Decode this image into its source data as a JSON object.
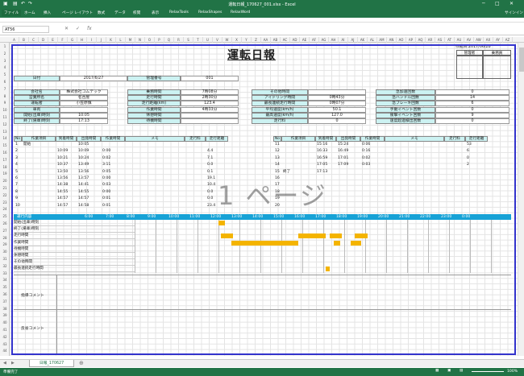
{
  "app": {
    "title": "運転日報_170627_001.xlsx - Excel",
    "signin": "サインイン"
  },
  "ribbon": {
    "tabs": [
      "ファイル",
      "ホーム",
      "挿入",
      "ページ レイアウト",
      "数式",
      "データ",
      "校閲",
      "表示",
      "RelaxTools",
      "RelaxShapes",
      "RelaxWord"
    ]
  },
  "formula": {
    "namebox": "AT56",
    "fx": "fx"
  },
  "sheet": {
    "title": "運転日報",
    "created": "作成日:2017/06/28",
    "stamps": [
      "管理者",
      "乗務員"
    ],
    "date_label": "日付",
    "date_value": "2017/6/27",
    "mgmt_label": "管理番号",
    "mgmt_value": "001",
    "info": {
      "left": [
        [
          "会社名",
          "株式会社コムテック"
        ],
        [
          "営業所名",
          "名古屋"
        ],
        [
          "運転者",
          "小笠原慎"
        ],
        [
          "車両",
          ""
        ],
        [
          "開始(出庫)時刻",
          "10:05"
        ],
        [
          "終了(帰庫)時刻",
          "17:13"
        ]
      ],
      "mid": [
        [
          "乗務時間",
          "7時08分"
        ],
        [
          "走行時間",
          "2時30分"
        ],
        [
          "走行距離(km)",
          "123.4"
        ],
        [
          "作業時間",
          "4時33分"
        ],
        [
          "休憩時間",
          ""
        ],
        [
          "待機時間",
          ""
        ]
      ],
      "mid2": [
        [
          "その他時間",
          ""
        ],
        [
          "アイドリング時間",
          "0時43分"
        ],
        [
          "最長連続走行時間",
          "0時07分"
        ],
        [
          "平均速度(km/h)",
          "50.1"
        ],
        [
          "最高速度(km/h)",
          "127.0"
        ],
        [
          "走行料",
          "0"
        ]
      ],
      "right": [
        [
          "急加速回数",
          "0"
        ],
        [
          "急ハンドル回数",
          "14"
        ],
        [
          "急ブレーキ回数",
          "6"
        ],
        [
          "手動イベント回数",
          "0"
        ],
        [
          "衝撃イベント回数",
          "9"
        ],
        [
          "速度超過検出回数",
          "0"
        ]
      ]
    },
    "log_headers": [
      "No",
      "作業項目",
      "到着時間",
      "出発時間",
      "作業時間",
      "メモ",
      "走行料",
      "走行距離"
    ],
    "log_left": [
      [
        "1",
        "開始",
        "",
        "10:05",
        "",
        "",
        "",
        ""
      ],
      [
        "2",
        "",
        "10:09",
        "10:09",
        "0:00",
        "",
        "",
        "4.4"
      ],
      [
        "3",
        "",
        "10:21",
        "10:24",
        "0:02",
        "",
        "",
        "7.1"
      ],
      [
        "4",
        "",
        "10:37",
        "13:49",
        "3:11",
        "",
        "",
        "0.0"
      ],
      [
        "5",
        "",
        "13:50",
        "13:56",
        "0:05",
        "",
        "",
        "0.1"
      ],
      [
        "6",
        "",
        "13:56",
        "13:57",
        "0:00",
        "",
        "",
        "19.1"
      ],
      [
        "7",
        "",
        "14:38",
        "14:41",
        "0:03",
        "",
        "",
        "10.4"
      ],
      [
        "8",
        "",
        "14:55",
        "14:55",
        "0:00",
        "",
        "",
        "0.0"
      ],
      [
        "9",
        "",
        "14:57",
        "14:57",
        "0:01",
        "",
        "",
        "0.0"
      ],
      [
        "10",
        "",
        "14:57",
        "14:58",
        "0:01",
        "",
        "",
        "23.4"
      ]
    ],
    "log_right": [
      [
        "11",
        "",
        "15:16",
        "15:24",
        "0:06",
        "",
        "",
        "53"
      ],
      [
        "12",
        "",
        "16:33",
        "16:49",
        "0:16",
        "",
        "",
        "6"
      ],
      [
        "13",
        "",
        "16:59",
        "17:01",
        "0:02",
        "",
        "",
        "0"
      ],
      [
        "14",
        "",
        "17:05",
        "17:09",
        "0:03",
        "",
        "",
        "2"
      ],
      [
        "15",
        "終了",
        "17:13",
        "",
        "",
        "",
        "",
        ""
      ],
      [
        "16",
        "",
        "",
        "",
        "",
        "",
        "",
        ""
      ],
      [
        "17",
        "",
        "",
        "",
        "",
        "",
        "",
        ""
      ],
      [
        "18",
        "",
        "",
        "",
        "",
        "",
        "",
        ""
      ],
      [
        "19",
        "",
        "",
        "",
        "",
        "",
        "",
        ""
      ],
      [
        "20",
        "",
        "",
        "",
        "",
        "",
        "",
        ""
      ]
    ],
    "watermark": "1 ページ",
    "timeline_label": "運行内容",
    "timeline_hours": [
      "6:00",
      "7:00",
      "8:00",
      "9:00",
      "10:00",
      "11:00",
      "12:00",
      "13:00",
      "14:00",
      "15:00",
      "16:00",
      "17:00",
      "18:00",
      "19:00",
      "20:00",
      "21:00",
      "22:00",
      "23:00",
      "0:00"
    ],
    "timeline_rows": [
      "開始(出庫)時刻",
      "終了(帰庫)時刻",
      "走行時間",
      "作業時間",
      "待機時間",
      "休憩時間",
      "その他時間",
      "最長連続走行時間"
    ],
    "comments": [
      "指導コメント",
      "反省コメント"
    ],
    "row_numbers": [
      "1",
      "2",
      "3",
      "4",
      "5",
      "6",
      "7",
      "8",
      "9",
      "10",
      "11",
      "12",
      "13",
      "14",
      "15",
      "16",
      "17",
      "18",
      "19",
      "20",
      "21",
      "22",
      "23",
      "24",
      "25",
      "26",
      "27",
      "28",
      "29",
      "30",
      "31",
      "32",
      "33",
      "34",
      "35",
      "36",
      "37",
      "38",
      "39",
      "40",
      "41",
      "42",
      "43",
      "44"
    ],
    "col_letters": [
      "A",
      "B",
      "C",
      "D",
      "E",
      "F",
      "G",
      "H",
      "I",
      "J",
      "K",
      "L",
      "M",
      "N",
      "O",
      "P",
      "Q",
      "R",
      "S",
      "T",
      "U",
      "V",
      "W",
      "X",
      "Y",
      "Z",
      "AA",
      "AB",
      "AC",
      "AD",
      "AE",
      "AF",
      "AG",
      "AH",
      "AI",
      "AJ",
      "AK",
      "AL",
      "AM",
      "AN",
      "AO",
      "AP",
      "AQ",
      "AR",
      "AS",
      "AT",
      "AU",
      "AV",
      "AW",
      "AX",
      "AY",
      "AZ"
    ]
  },
  "sheettab": "日報_170627",
  "status": {
    "left": "準備完了",
    "zoom": "100%"
  },
  "colors": {
    "excel_green": "#217346",
    "label_bg": "#ccf2f2",
    "timeline_bg": "#17a2d6",
    "bar": "#f4b400"
  }
}
